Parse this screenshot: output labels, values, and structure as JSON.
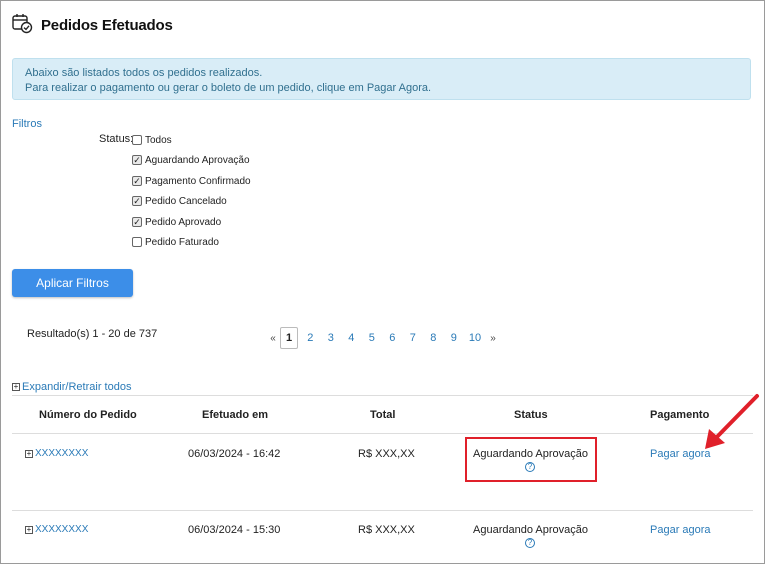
{
  "header": {
    "title": "Pedidos Efetuados",
    "icon": "calendar-check-icon"
  },
  "info": {
    "line1": "Abaixo são listados todos os pedidos realizados.",
    "line2": "Para realizar o pagamento ou gerar o boleto de um pedido, clique em Pagar Agora."
  },
  "filters": {
    "link": "Filtros",
    "status_label": "Status:",
    "options": [
      {
        "label": "Todos",
        "checked": false
      },
      {
        "label": "Aguardando Aprovação",
        "checked": true
      },
      {
        "label": "Pagamento Confirmado",
        "checked": true
      },
      {
        "label": "Pedido Cancelado",
        "checked": true
      },
      {
        "label": "Pedido Aprovado",
        "checked": true
      },
      {
        "label": "Pedido Faturado",
        "checked": false
      }
    ],
    "apply_label": "Aplicar Filtros"
  },
  "results": {
    "text": "Resultado(s) 1 - 20 de 737"
  },
  "pager": {
    "prev": "«",
    "pages": [
      "1",
      "2",
      "3",
      "4",
      "5",
      "6",
      "7",
      "8",
      "9",
      "10"
    ],
    "active": "1",
    "next": "»"
  },
  "expand_label": "Expandir/Retrair todos",
  "table": {
    "headers": [
      "Número do Pedido",
      "Efetuado em",
      "Total",
      "Status",
      "Pagamento"
    ],
    "rows": [
      {
        "order": "XXXXXXXX",
        "date": "06/03/2024 - 16:42",
        "total": "R$ XXX,XX",
        "status": "Aguardando Aprovação",
        "payment": "Pagar agora"
      },
      {
        "order": "XXXXXXXX",
        "date": "06/03/2024 - 15:30",
        "total": "R$ XXX,XX",
        "status": "Aguardando Aprovação",
        "payment": "Pagar agora"
      }
    ]
  },
  "colors": {
    "accent": "#3c8ee8",
    "link": "#2a7ab7",
    "info_bg": "#d9edf7",
    "annotation_red": "#e0202a"
  }
}
